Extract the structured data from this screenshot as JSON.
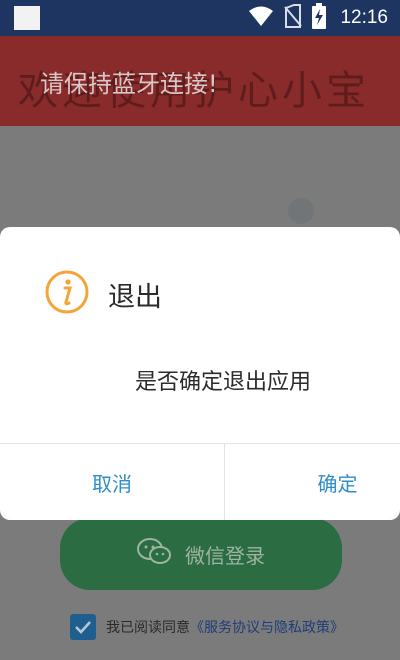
{
  "status_bar": {
    "time": "12:16",
    "icons": [
      "wifi-icon",
      "no-sim-icon",
      "battery-charging-icon"
    ]
  },
  "banner": {
    "background_text": "欢迎使用护心小宝",
    "message": "请保持蓝牙连接!"
  },
  "dialog": {
    "title": "退出",
    "message": "是否确定退出应用",
    "cancel_label": "取消",
    "confirm_label": "确定",
    "icon": "info-icon"
  },
  "login": {
    "wechat_label": "微信登录",
    "wechat_icon": "wechat-icon"
  },
  "agreement": {
    "checked": true,
    "prefix": "我已阅读同意",
    "link": "《服务协议与隐私政策》"
  },
  "colors": {
    "status_bar": "#1d3560",
    "banner": "#8a2b2b",
    "wechat_button": "#2c6c42",
    "dialog_button_text": "#2e8ec9",
    "info_icon": "#f3a53a"
  }
}
